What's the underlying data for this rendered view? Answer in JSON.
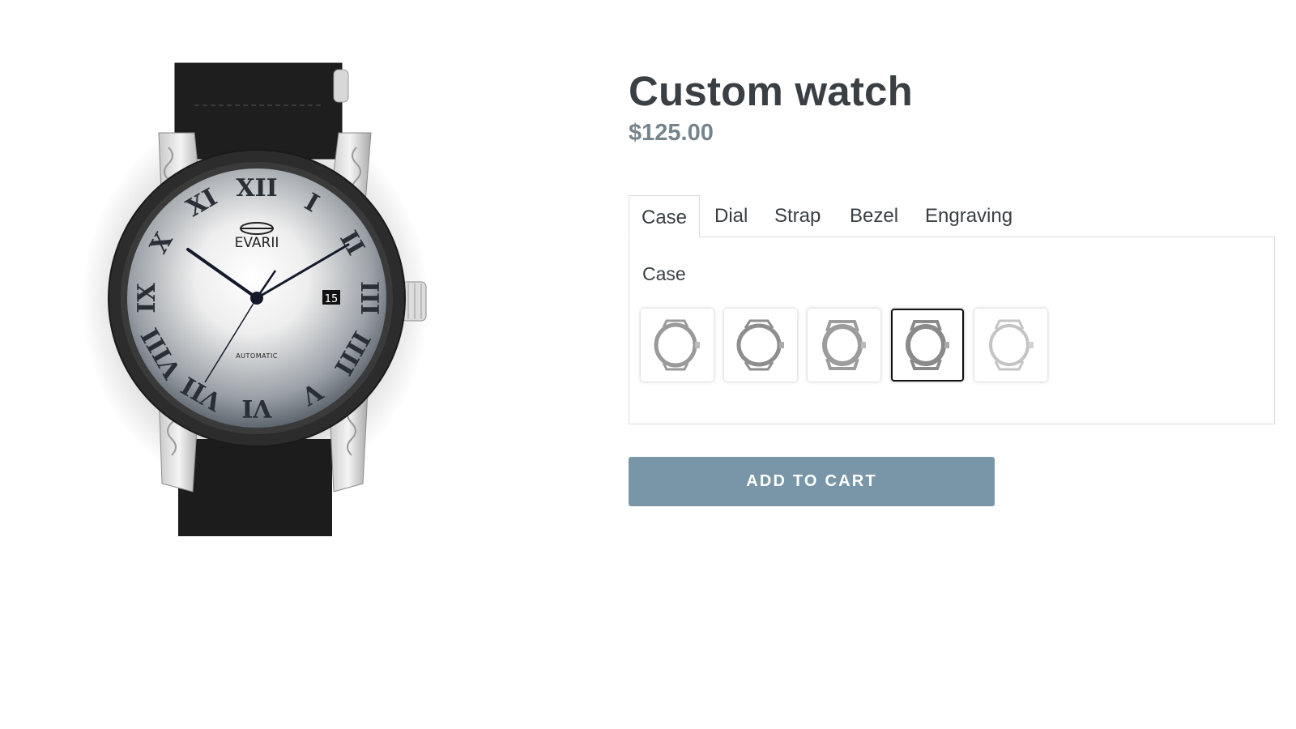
{
  "product": {
    "title": "Custom watch",
    "price": "$125.00"
  },
  "watch_image": {
    "brand": "EVARII",
    "dial_text": "AUTOMATIC",
    "date": "15",
    "numerals": [
      "XII",
      "I",
      "II",
      "III",
      "IIII",
      "V",
      "VI",
      "VII",
      "VIII",
      "IX",
      "X",
      "XI"
    ]
  },
  "tabs": [
    {
      "label": "Case",
      "active": true
    },
    {
      "label": "Dial",
      "active": false
    },
    {
      "label": "Strap",
      "active": false
    },
    {
      "label": "Bezel",
      "active": false
    },
    {
      "label": "Engraving",
      "active": false
    }
  ],
  "panel": {
    "label": "Case",
    "swatches": [
      {
        "icon": "watch-case-icon",
        "selected": false
      },
      {
        "icon": "watch-case-icon",
        "selected": false
      },
      {
        "icon": "watch-case-icon",
        "selected": false
      },
      {
        "icon": "watch-case-icon",
        "selected": true
      },
      {
        "icon": "watch-case-icon",
        "selected": false
      }
    ]
  },
  "cart": {
    "button_label": "ADD TO CART"
  },
  "colors": {
    "title": "#3a3f44",
    "price": "#76848d",
    "button": "#7896a8",
    "border": "#d9dcdf"
  }
}
